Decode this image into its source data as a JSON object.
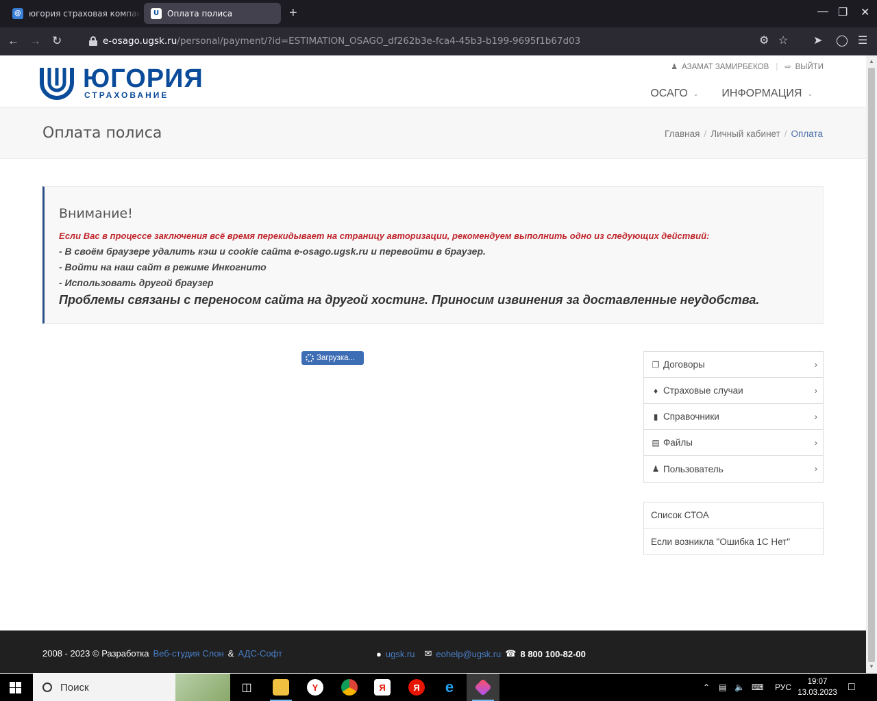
{
  "browser": {
    "tabs": [
      {
        "title": "югория страховая компания",
        "favicon": "mail-ru-icon"
      },
      {
        "title": "Оплата полиса",
        "favicon": "ugsk-icon"
      }
    ],
    "url_host": "e-osago.ugsk.ru",
    "url_path": "/personal/payment/?id=ESTIMATION_OSAGO_df262b3e-fca4-45b3-b199-9695f1b67d03"
  },
  "header": {
    "logo_main": "ЮГОРИЯ",
    "logo_sub": "СТРАХОВАНИЕ",
    "user_name": "АЗАМАТ ЗАМИРБЕКОВ",
    "logout": "ВЫЙТИ",
    "nav": [
      {
        "label": "ОСАГО"
      },
      {
        "label": "ИНФОРМАЦИЯ"
      }
    ]
  },
  "titlebar": {
    "title": "Оплата полиса",
    "breadcrumbs": [
      "Главная",
      "Личный кабинет",
      "Оплата"
    ]
  },
  "alert": {
    "title": "Внимание!",
    "red_text": "Если Вас в процессе заключения всё время перекидывает на страницу авторизации, рекомендуем выполнить одно из следующих действий:",
    "lines": [
      "- В своём браузере удалить кэш и cookie сайта e-osago.ugsk.ru и перевойти в браузер.",
      "- Войти на наш сайт в режиме Инкогнито",
      "- Использовать другой браузер"
    ],
    "big_text": "Проблемы связаны с переносом сайта на другой хостинг. Приносим извинения за доставленные неудобства."
  },
  "loading_label": "Загрузка...",
  "sidemenu": [
    {
      "label": "Договоры",
      "icon": "copy-icon"
    },
    {
      "label": "Страховые случаи",
      "icon": "bell-icon"
    },
    {
      "label": "Справочники",
      "icon": "folder-open-icon"
    },
    {
      "label": "Файлы",
      "icon": "file-icon"
    },
    {
      "label": "Пользователь",
      "icon": "user-icon"
    }
  ],
  "sidelinks": [
    {
      "label": "Список СТОА"
    },
    {
      "label": "Если возникла \"Ошибка 1С Нет\""
    }
  ],
  "footer": {
    "copyright": "2008 - 2023 © Разработка",
    "dev1": "Веб-студия Слон",
    "amp": "&",
    "dev2": "АДС-Софт",
    "site": "ugsk.ru",
    "email": "eohelp@ugsk.ru",
    "phone": "8 800 100-82-00"
  },
  "taskbar": {
    "search_placeholder": "Поиск",
    "lang": "РУС",
    "time": "19:07",
    "date": "13.03.2023"
  }
}
